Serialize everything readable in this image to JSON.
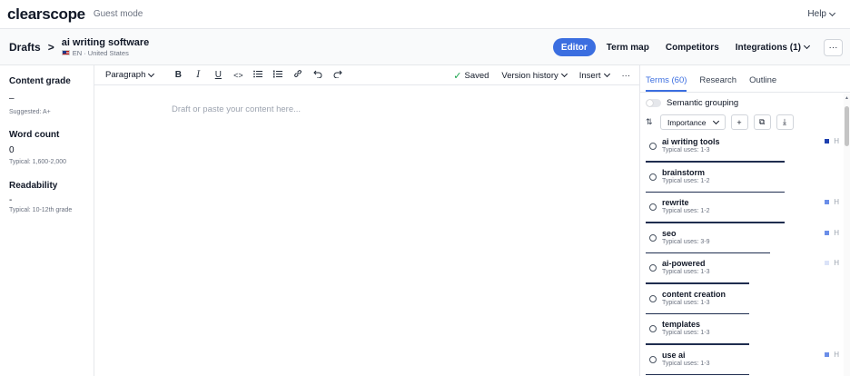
{
  "app": {
    "logo": "clearscope",
    "mode": "Guest mode",
    "help_label": "Help"
  },
  "breadcrumb": {
    "root": "Drafts",
    "separator": ">",
    "doc_title": "ai writing software",
    "locale": "EN · United States"
  },
  "header_actions": {
    "editor": "Editor",
    "term_map": "Term map",
    "competitors": "Competitors",
    "integrations": "Integrations (1)",
    "more": "···"
  },
  "left_panel": {
    "content_grade": {
      "title": "Content grade",
      "value": "–",
      "sub": "Suggested: A+"
    },
    "word_count": {
      "title": "Word count",
      "value": "0",
      "sub": "Typical: 1,600-2,000"
    },
    "readability": {
      "title": "Readability",
      "value": "-",
      "sub": "Typical: 10-12th grade"
    }
  },
  "toolbar": {
    "paragraph": "Paragraph",
    "bold": "B",
    "italic": "I",
    "underline": "U",
    "code": "<>",
    "bullet_list": "☰",
    "numbered_list": "☷",
    "link": "🔗",
    "undo": "↶",
    "redo": "↷",
    "saved": "Saved",
    "version_history": "Version history",
    "insert": "Insert",
    "more": "···"
  },
  "editor": {
    "placeholder": "Draft or paste your content here..."
  },
  "right_panel": {
    "tabs": [
      "Terms (60)",
      "Research",
      "Outline"
    ],
    "semantic_grouping": "Semantic grouping",
    "sort_label": "Importance",
    "add": "+",
    "copy": "⧉",
    "download": "⤓",
    "terms": [
      {
        "name": "ai writing tools",
        "uses": "Typical uses: 1-3",
        "heading": "H",
        "dot_color": "#1e40af",
        "importance": 0.66
      },
      {
        "name": "brainstorm",
        "uses": "Typical uses: 1-2",
        "heading": "",
        "dot_color": "",
        "importance": 0.66
      },
      {
        "name": "rewrite",
        "uses": "Typical uses: 1-2",
        "heading": "H",
        "dot_color": "#6b8ee8",
        "importance": 0.66
      },
      {
        "name": "seo",
        "uses": "Typical uses: 3-9",
        "heading": "H",
        "dot_color": "#6b8ee8",
        "importance": 0.59
      },
      {
        "name": "ai-powered",
        "uses": "Typical uses: 1-3",
        "heading": "H",
        "dot_color": "#dbe3f8",
        "importance": 0.49
      },
      {
        "name": "content creation",
        "uses": "Typical uses: 1-3",
        "heading": "",
        "dot_color": "",
        "importance": 0.49
      },
      {
        "name": "templates",
        "uses": "Typical uses: 1-3",
        "heading": "",
        "dot_color": "",
        "importance": 0.49
      },
      {
        "name": "use ai",
        "uses": "Typical uses: 1-3",
        "heading": "H",
        "dot_color": "#6b8ee8",
        "importance": 0.49
      }
    ]
  },
  "colors": {
    "accent": "#3b6ee0",
    "bar": "#1f2d4f",
    "saved_check": "#16a34a"
  }
}
